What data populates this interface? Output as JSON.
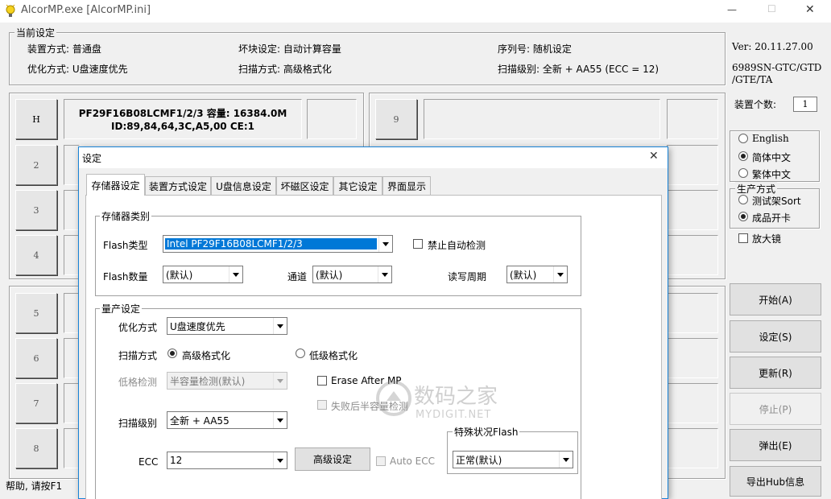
{
  "window": {
    "title": "AlcorMP.exe [AlcorMP.ini]",
    "min_glyph": "—",
    "max_glyph": "☐",
    "close_glyph": "✕"
  },
  "current_settings": {
    "title": "当前设定",
    "install_mode": "装置方式: 普通盘",
    "bad_block": "坏块设定: 自动计算容量",
    "serial": "序列号: 随机设定",
    "optimize": "优化方式: U盘速度优先",
    "scan_mode": "扫描方式: 高级格式化",
    "scan_level": "扫描级别: 全新 + AA55 (ECC = 12)"
  },
  "version": {
    "line1": "Ver: 20.11.27.00",
    "line2": "6989SN-GTC/GTD",
    "line3": "/GTE/TA"
  },
  "device_count": {
    "label": "装置个数:",
    "value": "1"
  },
  "language": {
    "english": "English",
    "simplified": "简体中文",
    "traditional": "繁体中文"
  },
  "production": {
    "title": "生产方式",
    "test_rack": "测试架Sort",
    "finished": "成品开卡",
    "magnifier": "放大镜"
  },
  "side_buttons": {
    "start": "开始(A)",
    "settings": "设定(S)",
    "update": "更新(R)",
    "stop": "停止(P)",
    "eject": "弹出(E)",
    "export_hub": "导出Hub信息"
  },
  "ports": {
    "p1": {
      "label": "H",
      "info1": "PF29F16B08LCMF1/2/3 容量: 16384.0M",
      "info2": "ID:89,84,64,3C,A5,00 CE:1"
    },
    "p2": "2",
    "p3": "3",
    "p4": "4",
    "p5": "5",
    "p6": "6",
    "p7": "7",
    "p8": "8",
    "p9": "9"
  },
  "status_bar": "帮助, 请按F1",
  "dialog": {
    "title": "设定",
    "close_glyph": "✕",
    "tabs": [
      "存储器设定",
      "装置方式设定",
      "U盘信息设定",
      "坏磁区设定",
      "其它设定",
      "界面显示"
    ],
    "storage": {
      "group_title": "存储器类别",
      "flash_type_label": "Flash类型",
      "flash_type_value": "Intel PF29F16B08LCMF1/2/3",
      "disable_detect": "禁止自动检测",
      "flash_count_label": "Flash数量",
      "flash_count_value": "(默认)",
      "channel_label": "通道",
      "channel_value": "(默认)",
      "rw_cycle_label": "读写周期",
      "rw_cycle_value": "(默认)"
    },
    "mp": {
      "group_title": "量产设定",
      "optimize_label": "优化方式",
      "optimize_value": "U盘速度优先",
      "scan_label": "扫描方式",
      "scan_high": "高级格式化",
      "scan_low": "低级格式化",
      "lowfmt_label": "低格检测",
      "lowfmt_value": "半容量检测(默认)",
      "erase_after": "Erase After MP",
      "fail_half": "失败后半容量检测",
      "level_label": "扫描级别",
      "level_value": "全新 + AA55",
      "ecc_label": "ECC",
      "ecc_value": "12",
      "advanced_btn": "高级设定",
      "auto_ecc": "Auto ECC",
      "special_title": "特殊状况Flash",
      "special_value": "正常(默认)"
    }
  },
  "watermark": {
    "cn": "数码之家",
    "en": "MYDIGIT.NET"
  }
}
